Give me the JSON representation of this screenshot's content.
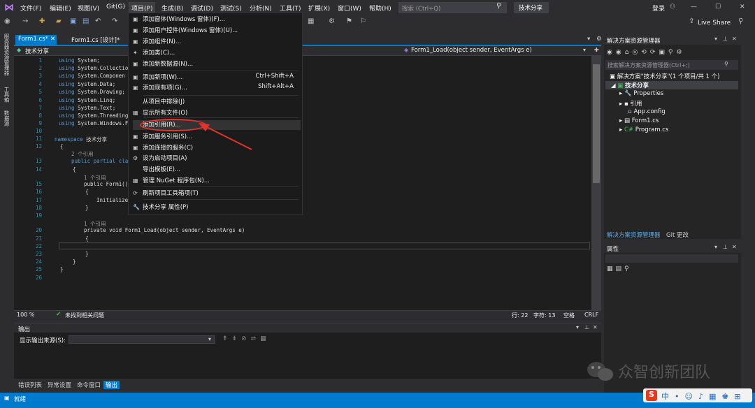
{
  "menubar": {
    "items": [
      "文件(F)",
      "编辑(E)",
      "视图(V)",
      "Git(G)",
      "项目(P)",
      "生成(B)",
      "调试(D)",
      "测试(S)",
      "分析(N)",
      "工具(T)",
      "扩展(X)",
      "窗口(W)",
      "帮助(H)"
    ],
    "search_placeholder": "搜索 (Ctrl+Q)",
    "project_badge": "技术分享",
    "login": "登录",
    "live_share": "Live Share"
  },
  "doc_tabs": [
    "Form1.cs*",
    "Form1.cs [设计]*"
  ],
  "navbar": {
    "left": "技术分享",
    "right": "Form1_Load(object sender, EventArgs e)"
  },
  "left_strip": [
    "服务器资源管理器",
    "工具箱",
    "数据源"
  ],
  "code": {
    "line_numbers": [
      "1",
      "2",
      "3",
      "4",
      "5",
      "6",
      "7",
      "8",
      "9",
      "10",
      "11",
      "12",
      "13",
      "14",
      "15",
      "16",
      "17",
      "18",
      "19",
      "20",
      "21",
      "22",
      "23",
      "24",
      "25",
      "26"
    ],
    "using_lines": [
      "System;",
      "System.Collectio",
      "System.Componen",
      "System.Data;",
      "System.Drawing;",
      "System.Linq;",
      "System.Text;",
      "System.Threading",
      "System.Windows.F"
    ],
    "namespace_name": "技术分享",
    "ref_count_1": "2 个引用",
    "partial_class": "public partial cla",
    "ref_count_2": "1 个引用",
    "ctor": "public Form1()",
    "init": "Initialize",
    "ref_count_3": "1 个引用",
    "load_sig": "private void Form1_Load(object sender, EventArgs e)"
  },
  "project_menu": {
    "items": [
      {
        "label": "添加窗体(Windows 窗体)(F)...",
        "shortcut": ""
      },
      {
        "label": "添加用户控件(Windows 窗体)(U)...",
        "shortcut": ""
      },
      {
        "label": "添加组件(N)...",
        "shortcut": ""
      },
      {
        "label": "添加类(C)...",
        "shortcut": ""
      },
      {
        "label": "添加新数据源(N)...",
        "shortcut": ""
      },
      {
        "label": "添加新项(W)...",
        "shortcut": "Ctrl+Shift+A"
      },
      {
        "label": "添加现有项(G)...",
        "shortcut": "Shift+Alt+A"
      },
      {
        "label": "从项目中排除(J)",
        "shortcut": ""
      },
      {
        "label": "显示所有文件(O)",
        "shortcut": ""
      },
      {
        "label": "添加引用(R)...",
        "shortcut": ""
      },
      {
        "label": "添加服务引用(S)...",
        "shortcut": ""
      },
      {
        "label": "添加连接的服务(C)",
        "shortcut": ""
      },
      {
        "label": "设为启动项目(A)",
        "shortcut": ""
      },
      {
        "label": "导出模板(E)...",
        "shortcut": ""
      },
      {
        "label": "管理 NuGet 程序包(N)...",
        "shortcut": ""
      },
      {
        "label": "刷新项目工具箱项(T)",
        "shortcut": ""
      },
      {
        "label": "技术分享 属性(P)",
        "shortcut": ""
      }
    ]
  },
  "editor_status": {
    "zoom": "100 %",
    "issues": "未找到相关问题",
    "line": "行: 22",
    "char": "字符: 13",
    "space": "空格",
    "crlf": "CRLF"
  },
  "solution_explorer": {
    "title": "解决方案资源管理器",
    "search_placeholder": "搜索解决方案资源管理器(Ctrl+;)",
    "solution": "解决方案\"技术分享\"(1 个项目/共 1 个)",
    "project": "技术分享",
    "nodes": [
      "Properties",
      "引用",
      "App.config",
      "Form1.cs",
      "Program.cs"
    ],
    "tabs": [
      "解决方案资源管理器",
      "Git 更改"
    ]
  },
  "properties": {
    "title": "属性"
  },
  "output": {
    "title": "输出",
    "source_label": "显示输出来源(S):"
  },
  "bottom_tabs": [
    "错误列表",
    "异常设置",
    "命令窗口",
    "输出"
  ],
  "statusbar": {
    "ready": "就绪"
  },
  "watermark": {
    "text": "众智创新团队"
  }
}
